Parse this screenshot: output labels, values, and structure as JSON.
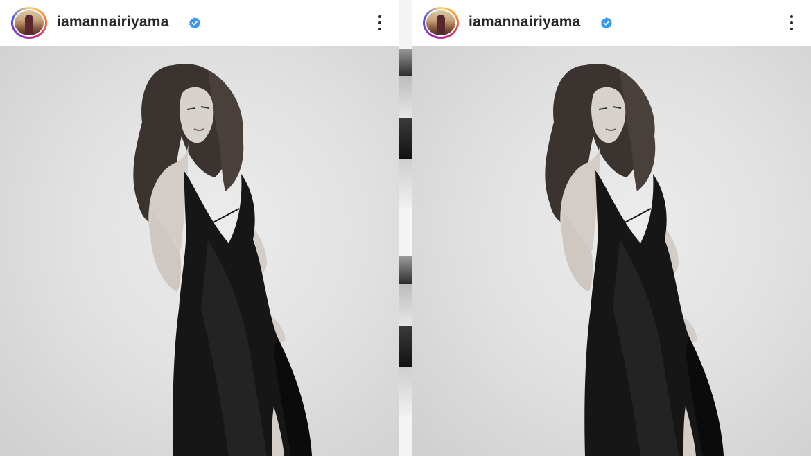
{
  "posts": [
    {
      "username": "iamannairiyama",
      "verified_icon": "verified-badge-icon",
      "menu_icon": "more-options-icon",
      "accent": "#3897f0"
    },
    {
      "username": "iamannairiyama",
      "verified_icon": "verified-badge-icon",
      "menu_icon": "more-options-icon",
      "accent": "#3897f0"
    }
  ]
}
